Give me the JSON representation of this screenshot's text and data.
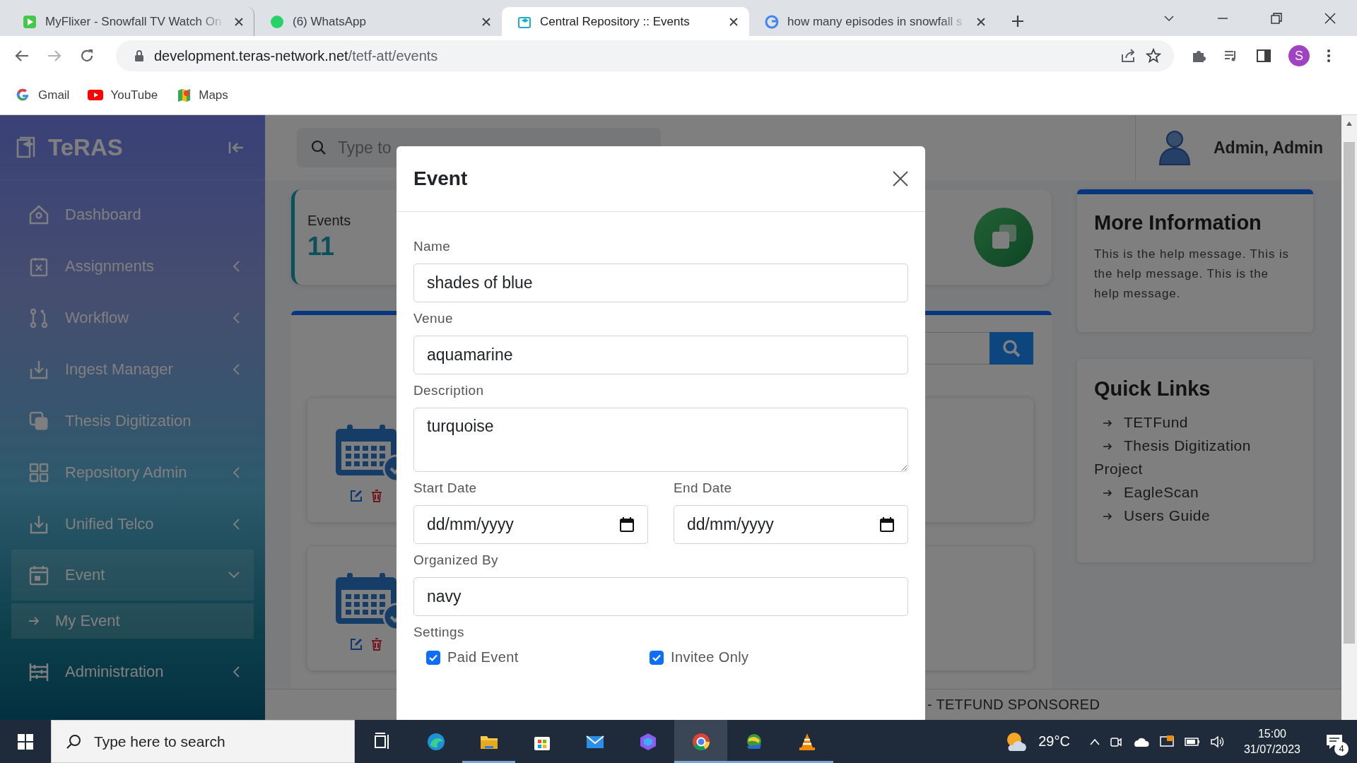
{
  "browser": {
    "tabs": [
      {
        "title": "MyFlixer - Snowfall TV Watch On",
        "selected": false
      },
      {
        "title": "(6) WhatsApp",
        "selected": false
      },
      {
        "title": "Central Repository :: Events",
        "selected": true
      },
      {
        "title": "how many episodes in snowfall s",
        "selected": false
      }
    ],
    "address": {
      "domain": "development.teras-network.net",
      "path": "/tetf-att/events"
    },
    "profile_initial": "S",
    "bookmarks": [
      "Gmail",
      "YouTube",
      "Maps"
    ]
  },
  "app": {
    "logo": "TeRAS",
    "search": {
      "placeholder": "Type to"
    },
    "user": "Admin, Admin",
    "sidebar": {
      "items": [
        {
          "label": "Dashboard",
          "has_submenu": false,
          "expanded": false,
          "selected": false
        },
        {
          "label": "Assignments",
          "has_submenu": true,
          "expanded": false,
          "selected": false
        },
        {
          "label": "Workflow",
          "has_submenu": true,
          "expanded": false,
          "selected": false
        },
        {
          "label": "Ingest Manager",
          "has_submenu": true,
          "expanded": false,
          "selected": false
        },
        {
          "label": "Thesis Digitization",
          "has_submenu": false,
          "expanded": false,
          "selected": false
        },
        {
          "label": "Repository Admin",
          "has_submenu": true,
          "expanded": false,
          "selected": false
        },
        {
          "label": "Unified Telco",
          "has_submenu": true,
          "expanded": false,
          "selected": false
        },
        {
          "label": "Event",
          "has_submenu": true,
          "expanded": true,
          "selected": false,
          "children": [
            {
              "label": "My Event",
              "selected": true
            }
          ]
        },
        {
          "label": "Administration",
          "has_submenu": true,
          "expanded": false,
          "selected": false
        }
      ]
    },
    "summary_card": {
      "label": "Events",
      "count": "11"
    },
    "more_info": {
      "title": "More Information",
      "text": "This is the help message. This is the help message. This is the help message."
    },
    "quick_links": {
      "title": "Quick Links",
      "links": [
        "TETFund",
        "Thesis Digitization Project",
        "EagleScan",
        "Users Guide"
      ]
    },
    "footer": "- TETFUND SPONSORED"
  },
  "modal": {
    "title": "Event",
    "fields": [
      {
        "kind": "text",
        "label": "Name",
        "value": "shades of blue"
      },
      {
        "kind": "text",
        "label": "Venue",
        "value": "aquamarine"
      },
      {
        "kind": "textarea",
        "label": "Description",
        "value": "turquoise"
      },
      {
        "kind": "date",
        "label": "Start Date",
        "placeholder": "dd/mm/yyyy"
      },
      {
        "kind": "date",
        "label": "End Date",
        "placeholder": "dd/mm/yyyy"
      },
      {
        "kind": "text",
        "label": "Organized By",
        "value": "navy"
      }
    ],
    "settings": {
      "label": "Settings",
      "options": [
        {
          "label": "Paid Event",
          "checked": true
        },
        {
          "label": "Invitee Only",
          "checked": true
        }
      ]
    }
  },
  "taskbar": {
    "search_placeholder": "Type here to search",
    "apps": [
      {
        "running": false,
        "active": false
      },
      {
        "running": false,
        "active": false
      },
      {
        "running": true,
        "active": false
      },
      {
        "running": false,
        "active": false
      },
      {
        "running": false,
        "active": false
      },
      {
        "running": false,
        "active": false
      },
      {
        "running": true,
        "active": true
      },
      {
        "running": true,
        "active": false
      },
      {
        "running": true,
        "active": false
      }
    ],
    "weather": "29°C",
    "time": "15:00",
    "date": "31/07/2023",
    "notifications": "4"
  }
}
